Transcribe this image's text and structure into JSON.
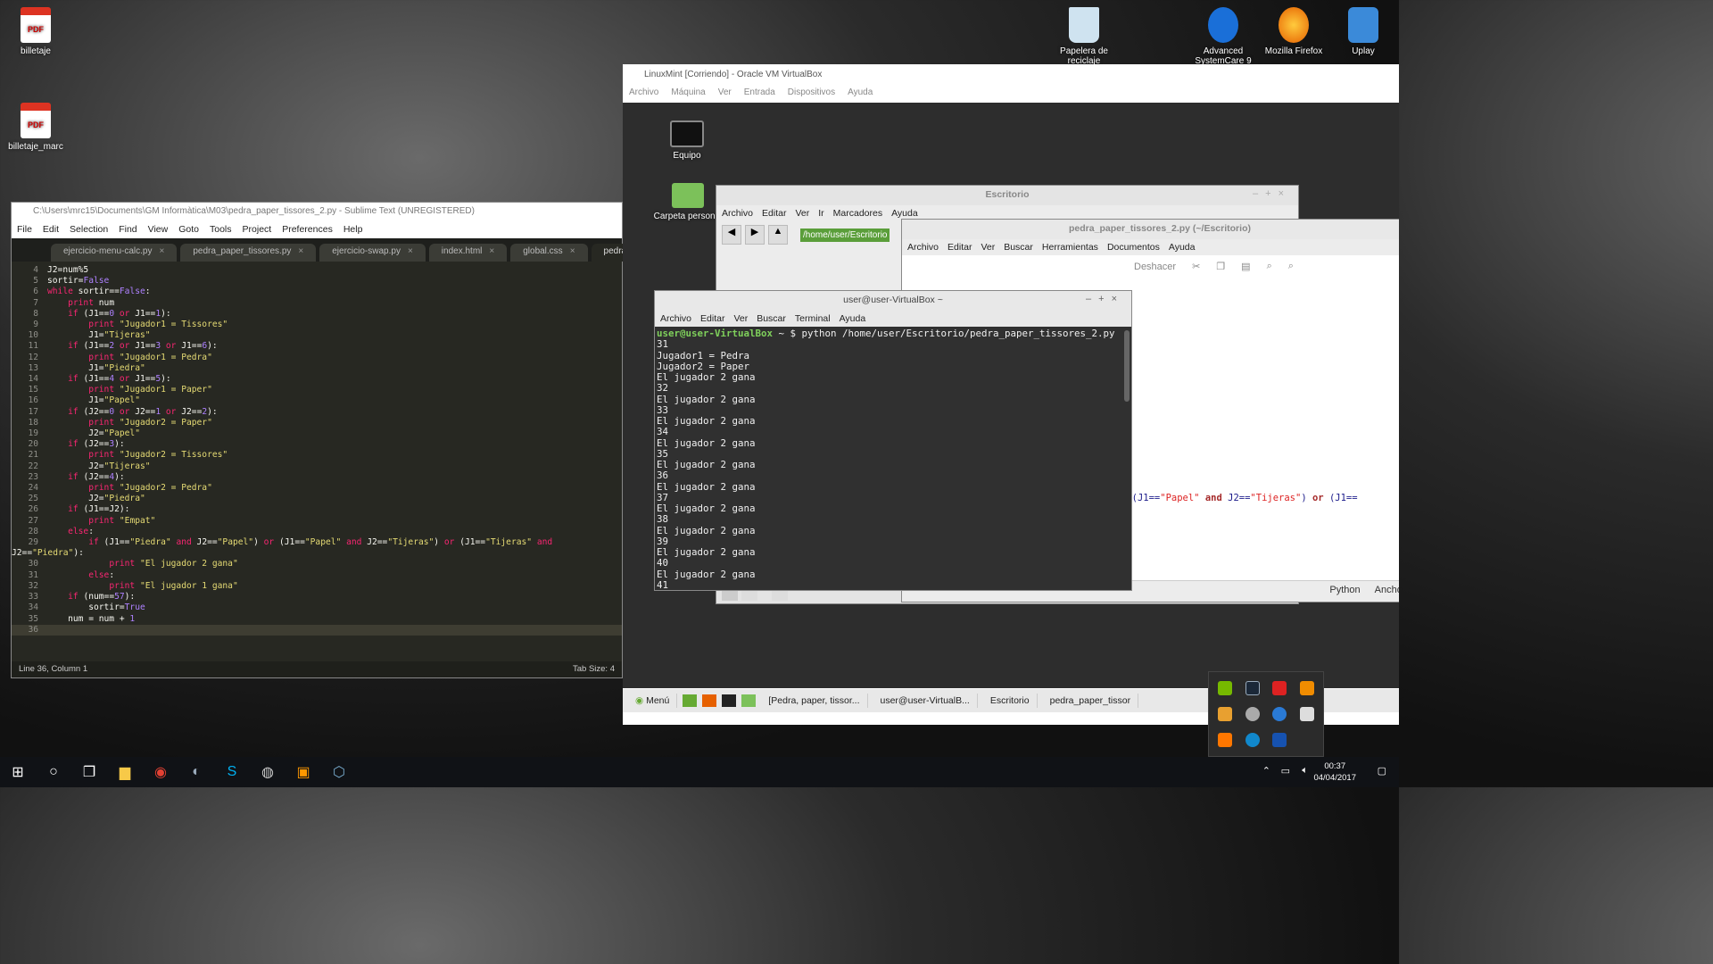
{
  "desktop_icons": {
    "left1": "billetaje",
    "left2": "billetaje_marc",
    "recycle": "Papelera de reciclaje",
    "asc": "Advanced SystemCare 9",
    "firefox": "Mozilla Firefox",
    "uplay": "Uplay",
    "pdf_badge": "PDF"
  },
  "sublime": {
    "title": "C:\\Users\\mrc15\\Documents\\GM Informàtica\\M03\\pedra_paper_tissores_2.py - Sublime Text (UNREGISTERED)",
    "menu": [
      "File",
      "Edit",
      "Selection",
      "Find",
      "View",
      "Goto",
      "Tools",
      "Project",
      "Preferences",
      "Help"
    ],
    "tabs": [
      "ejercicio-menu-calc.py",
      "pedra_paper_tissores.py",
      "ejercicio-swap.py",
      "index.html",
      "global.css",
      "pedra_paper_ti"
    ],
    "status_left": "Line 36, Column 1",
    "status_right": "Tab Size: 4"
  },
  "vbox": {
    "title": "LinuxMint [Corriendo] - Oracle VM VirtualBox",
    "menu": [
      "Archivo",
      "Máquina",
      "Ver",
      "Entrada",
      "Dispositivos",
      "Ayuda"
    ]
  },
  "mint": {
    "icon_equipo": "Equipo",
    "icon_carpeta": "Carpeta personal",
    "files_title": "Escritorio",
    "files_menu": [
      "Archivo",
      "Editar",
      "Ver",
      "Ir",
      "Marcadores",
      "Ayuda"
    ],
    "files_path": "/home/user/Escritorio",
    "gedit_title": "pedra_paper_tissores_2.py (~/Escritorio)",
    "gedit_menu": [
      "Archivo",
      "Editar",
      "Ver",
      "Buscar",
      "Herramientas",
      "Documentos",
      "Ayuda"
    ],
    "gedit_undo": "Deshacer",
    "gedit_lang": "Python",
    "gedit_width": "Ancho d",
    "terminal_title": "user@user-VirtualBox ~",
    "terminal_menu": [
      "Archivo",
      "Editar",
      "Ver",
      "Buscar",
      "Terminal",
      "Ayuda"
    ],
    "prompt_user": "user@user-VirtualBox",
    "prompt_cmd": " ~ $ python /home/user/Escritorio/pedra_paper_tissores_2.py",
    "terminal_lines": [
      "31",
      "Jugador1 = Pedra",
      "Jugador2 = Paper",
      "El jugador 2 gana",
      "32",
      "El jugador 2 gana",
      "33",
      "El jugador 2 gana",
      "34",
      "El jugador 2 gana",
      "35",
      "El jugador 2 gana",
      "36",
      "El jugador 2 gana",
      "37",
      "El jugador 2 gana",
      "38",
      "El jugador 2 gana",
      "39",
      "El jugador 2 gana",
      "40",
      "El jugador 2 gana",
      "41"
    ],
    "taskbar": [
      "Menú",
      "[Pedra, paper, tissor...",
      "user@user-VirtualB...",
      "Escritorio",
      "pedra_paper_tissor"
    ]
  },
  "windows": {
    "time": "00:37",
    "date": "04/04/2017"
  },
  "colors": {
    "sublime_bg": "#272822",
    "keyword": "#f92672",
    "string": "#e6db74",
    "number": "#ae81ff"
  }
}
